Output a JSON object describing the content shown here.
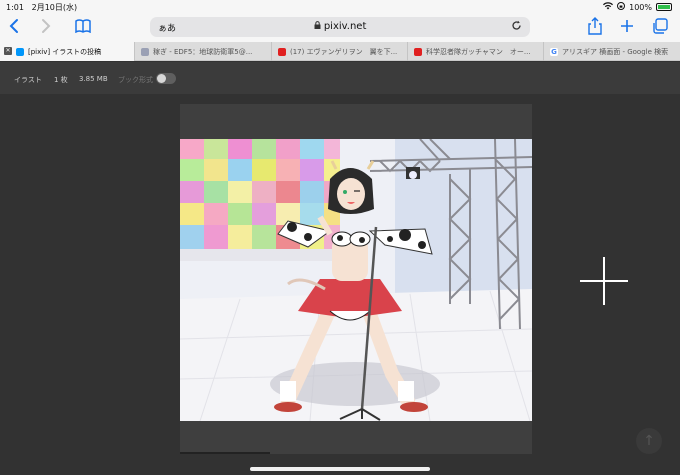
{
  "status": {
    "time": "1:01",
    "date": "2月10日(水)",
    "battery": "100%"
  },
  "toolbar": {
    "aa": "ぁあ",
    "url": "pixiv.net"
  },
  "tabs": [
    {
      "label": "[pixiv] イラストの投稿",
      "color": "#0096fa"
    },
    {
      "label": "稼ぎ - EDF5：地球防衛軍5@...",
      "color": "#9aa0b4"
    },
    {
      "label": "(17) エヴァンゲリヲン　翼を下...",
      "color": "#e02020"
    },
    {
      "label": "科学忍者隊ガッチャマン　オー...",
      "color": "#e02020"
    },
    {
      "label": "アリスギア 横画面 - Google 検索",
      "color": "#4285f4"
    }
  ],
  "pagebar": {
    "type": "イラスト",
    "count": "1 枚",
    "size": "3.85 MB",
    "book_label": "ブック形式"
  },
  "viewer": {
    "book_mode": false
  }
}
